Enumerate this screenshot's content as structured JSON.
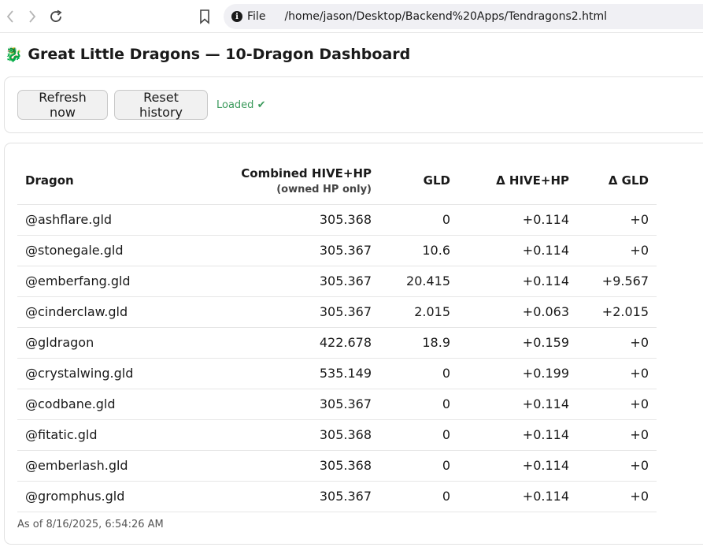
{
  "browser": {
    "scheme": "File",
    "url": "/home/jason/Desktop/Backend%20Apps/Tendragons2.html"
  },
  "page": {
    "icon": "🐉",
    "title": "Great Little Dragons — 10-Dragon Dashboard"
  },
  "controls": {
    "refresh_label": "Refresh now",
    "reset_label": "Reset history",
    "status": "Loaded ✔",
    "status_color": "#3a9a5b"
  },
  "table": {
    "headers": {
      "dragon": "Dragon",
      "hp": "Combined HIVE+HP",
      "hp_sub": "(owned HP only)",
      "gld": "GLD",
      "delta_hp": "Δ HIVE+HP",
      "delta_gld": "Δ GLD"
    },
    "rows": [
      {
        "dragon": "@ashflare.gld",
        "hp": "305.368",
        "gld": "0",
        "delta_hp": "+0.114",
        "delta_gld": "+0"
      },
      {
        "dragon": "@stonegale.gld",
        "hp": "305.367",
        "gld": "10.6",
        "delta_hp": "+0.114",
        "delta_gld": "+0"
      },
      {
        "dragon": "@emberfang.gld",
        "hp": "305.367",
        "gld": "20.415",
        "delta_hp": "+0.114",
        "delta_gld": "+9.567"
      },
      {
        "dragon": "@cinderclaw.gld",
        "hp": "305.367",
        "gld": "2.015",
        "delta_hp": "+0.063",
        "delta_gld": "+2.015"
      },
      {
        "dragon": "@gldragon",
        "hp": "422.678",
        "gld": "18.9",
        "delta_hp": "+0.159",
        "delta_gld": "+0"
      },
      {
        "dragon": "@crystalwing.gld",
        "hp": "535.149",
        "gld": "0",
        "delta_hp": "+0.199",
        "delta_gld": "+0"
      },
      {
        "dragon": "@codbane.gld",
        "hp": "305.367",
        "gld": "0",
        "delta_hp": "+0.114",
        "delta_gld": "+0"
      },
      {
        "dragon": "@fitatic.gld",
        "hp": "305.368",
        "gld": "0",
        "delta_hp": "+0.114",
        "delta_gld": "+0"
      },
      {
        "dragon": "@emberlash.gld",
        "hp": "305.368",
        "gld": "0",
        "delta_hp": "+0.114",
        "delta_gld": "+0"
      },
      {
        "dragon": "@gromphus.gld",
        "hp": "305.367",
        "gld": "0",
        "delta_hp": "+0.114",
        "delta_gld": "+0"
      }
    ]
  },
  "footer": {
    "as_of": "As of 8/16/2025, 6:54:26 AM"
  }
}
